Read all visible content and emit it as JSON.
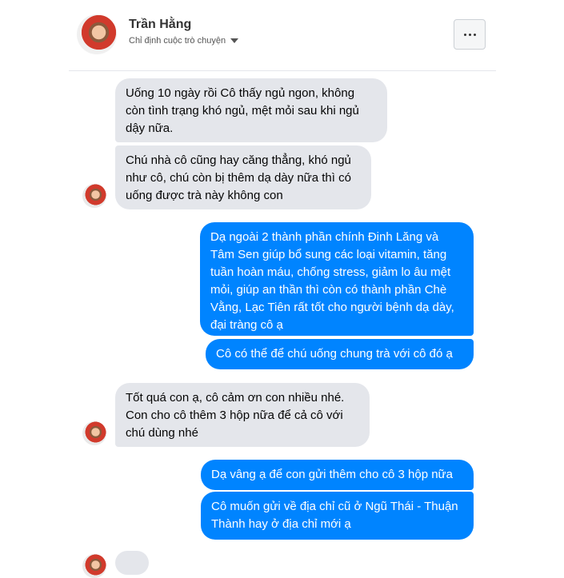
{
  "header": {
    "name": "Trần Hằng",
    "subtitle": "Chỉ định cuộc trò chuyện"
  },
  "messages": [
    {
      "from": "them",
      "text": "Uống 10 ngày rồi Cô thấy ngủ ngon, không còn tình trạng khó ngủ, mệt mỏi sau khi ngủ dậy nữa."
    },
    {
      "from": "them",
      "text": "Chú nhà cô cũng hay căng thẳng, khó ngủ như cô, chú còn bị thêm dạ dày nữa thì có uống được trà này không con"
    },
    {
      "from": "me",
      "text": "Dạ ngoài 2 thành phần chính Đinh Lăng và Tâm Sen giúp bổ sung các loại vitamin, tăng tuần hoàn máu, chống stress, giảm lo âu mệt mỏi, giúp an thần thì còn có thành phần Chè Vằng, Lạc Tiên rất tốt cho người bệnh dạ dày, đại tràng cô ạ"
    },
    {
      "from": "me",
      "text": "Cô có thể để chú uống chung trà với cô đó ạ"
    },
    {
      "from": "them",
      "text": "Tốt quá con ạ, cô cảm ơn con nhiều nhé. Con cho cô thêm 3 hộp nữa để cả cô với chú dùng nhé"
    },
    {
      "from": "me",
      "text": "Dạ vâng ạ để con gửi thêm cho cô 3 hộp nữa"
    },
    {
      "from": "me",
      "text": "Cô muốn gửi về địa chỉ cũ ở Ngũ Thái - Thuận Thành hay ở địa chỉ mới ạ"
    }
  ],
  "icons": {
    "more": "more-horizontal-icon",
    "dropdown": "caret-down-icon"
  },
  "colors": {
    "incoming_bubble": "#e4e6eb",
    "outgoing_bubble": "#0084ff"
  }
}
